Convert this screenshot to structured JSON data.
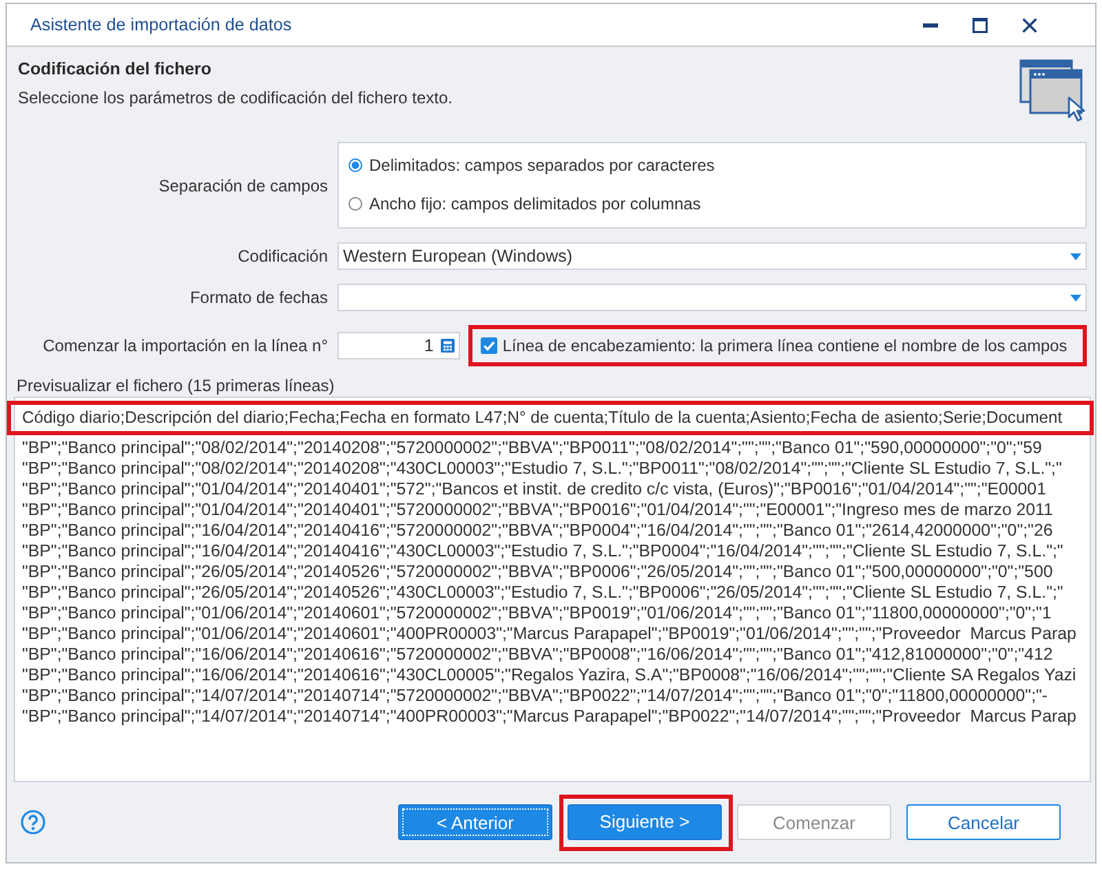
{
  "window": {
    "title": "Asistente de importación de datos"
  },
  "header": {
    "title": "Codificación del fichero",
    "subtitle": "Seleccione los parámetros de codificación del fichero texto."
  },
  "fields": [
    {
      "kind": "radio_group",
      "label": "Separación de campos",
      "options": [
        {
          "label": "Delimitados: campos separados por caracteres",
          "selected": true
        },
        {
          "label": "Ancho fijo: campos delimitados por columnas",
          "selected": false
        }
      ]
    },
    {
      "kind": "dropdown",
      "label": "Codificación",
      "value": "Western European (Windows)"
    },
    {
      "kind": "dropdown",
      "label": "Formato de fechas"
    },
    {
      "kind": "number",
      "label": "Comenzar la importación en la línea n°",
      "value": "1",
      "checkbox": {
        "label": "Línea de encabezamiento: la primera línea contiene el nombre de los campos",
        "checked": true,
        "highlighted": true
      }
    }
  ],
  "preview": {
    "title": "Previsualizar el fichero (15 primeras líneas)",
    "header_line": {
      "text": "Código diario;Descripción del diario;Fecha;Fecha en formato L47;N° de cuenta;Título de la cuenta;Asiento;Fecha de asiento;Serie;Document",
      "highlighted": true
    },
    "rows": [
      "\"BP\";\"Banco principal\";\"08/02/2014\";\"20140208\";\"5720000002\";\"BBVA\";\"BP0011\";\"08/02/2014\";\"\";\"\";\"Banco 01\";\"590,00000000\";\"0\";\"59",
      "\"BP\";\"Banco principal\";\"08/02/2014\";\"20140208\";\"430CL00003\";\"Estudio 7, S.L.\";\"BP0011\";\"08/02/2014\";\"\";\"\";\"Cliente SL Estudio 7, S.L.\";\"",
      "\"BP\";\"Banco principal\";\"01/04/2014\";\"20140401\";\"572\";\"Bancos et instit. de credito c/c vista, (Euros)\";\"BP0016\";\"01/04/2014\";\"\";\"E00001",
      "\"BP\";\"Banco principal\";\"01/04/2014\";\"20140401\";\"5720000002\";\"BBVA\";\"BP0016\";\"01/04/2014\";\"\";\"E00001\";\"Ingreso mes de marzo 2011",
      "\"BP\";\"Banco principal\";\"16/04/2014\";\"20140416\";\"5720000002\";\"BBVA\";\"BP0004\";\"16/04/2014\";\"\";\"\";\"Banco 01\";\"2614,42000000\";\"0\";\"26",
      "\"BP\";\"Banco principal\";\"16/04/2014\";\"20140416\";\"430CL00003\";\"Estudio 7, S.L.\";\"BP0004\";\"16/04/2014\";\"\";\"\";\"Cliente SL Estudio 7, S.L.\";\"",
      "\"BP\";\"Banco principal\";\"26/05/2014\";\"20140526\";\"5720000002\";\"BBVA\";\"BP0006\";\"26/05/2014\";\"\";\"\";\"Banco 01\";\"500,00000000\";\"0\";\"500",
      "\"BP\";\"Banco principal\";\"26/05/2014\";\"20140526\";\"430CL00003\";\"Estudio 7, S.L.\";\"BP0006\";\"26/05/2014\";\"\";\"\";\"Cliente SL Estudio 7, S.L.\";\"",
      "\"BP\";\"Banco principal\";\"01/06/2014\";\"20140601\";\"5720000002\";\"BBVA\";\"BP0019\";\"01/06/2014\";\"\";\"\";\"Banco 01\";\"11800,00000000\";\"0\";\"1",
      "\"BP\";\"Banco principal\";\"01/06/2014\";\"20140601\";\"400PR00003\";\"Marcus Parapapel\";\"BP0019\";\"01/06/2014\";\"\";\"\";\"Proveedor  Marcus Parap",
      "\"BP\";\"Banco principal\";\"16/06/2014\";\"20140616\";\"5720000002\";\"BBVA\";\"BP0008\";\"16/06/2014\";\"\";\"\";\"Banco 01\";\"412,81000000\";\"0\";\"412",
      "\"BP\";\"Banco principal\";\"16/06/2014\";\"20140616\";\"430CL00005\";\"Regalos Yazira, S.A\";\"BP0008\";\"16/06/2014\";\"\";\"\";\"Cliente SA Regalos Yazi",
      "\"BP\";\"Banco principal\";\"14/07/2014\";\"20140714\";\"5720000002\";\"BBVA\";\"BP0022\";\"14/07/2014\";\"\";\"\";\"Banco 01\";\"0\";\"11800,00000000\";\"-",
      "\"BP\";\"Banco principal\";\"14/07/2014\";\"20140714\";\"400PR00003\";\"Marcus Parapapel\";\"BP0022\";\"14/07/2014\";\"\";\"\";\"Proveedor  Marcus Parap"
    ]
  },
  "buttons": [
    {
      "label": "< Anterior",
      "kind": "primary",
      "focused": true,
      "disabled": false,
      "highlighted": false
    },
    {
      "label": "Siguiente >",
      "kind": "primary",
      "focused": false,
      "disabled": false,
      "highlighted": true
    },
    {
      "label": "Comenzar",
      "kind": "outline",
      "focused": false,
      "disabled": true,
      "highlighted": false
    },
    {
      "label": "Cancelar",
      "kind": "outline",
      "focused": false,
      "disabled": false,
      "highlighted": false
    }
  ]
}
